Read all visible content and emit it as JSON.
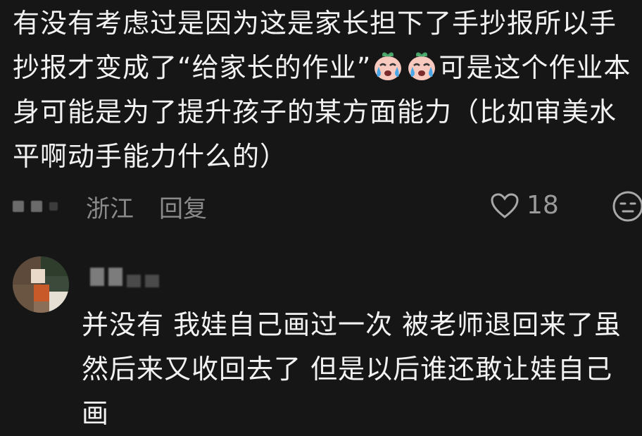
{
  "comment": {
    "text_before_emoji": "有没有考虑过是因为这是家长担下了手抄报所以手抄报才变成了“给家长的作业”",
    "emojis": [
      "crying-face-icon",
      "crying-face-icon"
    ],
    "text_after_emoji": "可是这个作业本身可能是为了提升孩子的某方面能力（比如审美水平啊动手能力什么的）",
    "location": "浙江",
    "reply_label": "回复",
    "like_count": "18"
  },
  "reply": {
    "text": "并没有 我娃自己画过一次 被老师退回来了虽然后来又收回去了 但是以后谁还敢让娃自己画"
  },
  "colors": {
    "background": "#161616",
    "text": "#f2f2f2",
    "meta_text": "#8a8a8a"
  }
}
